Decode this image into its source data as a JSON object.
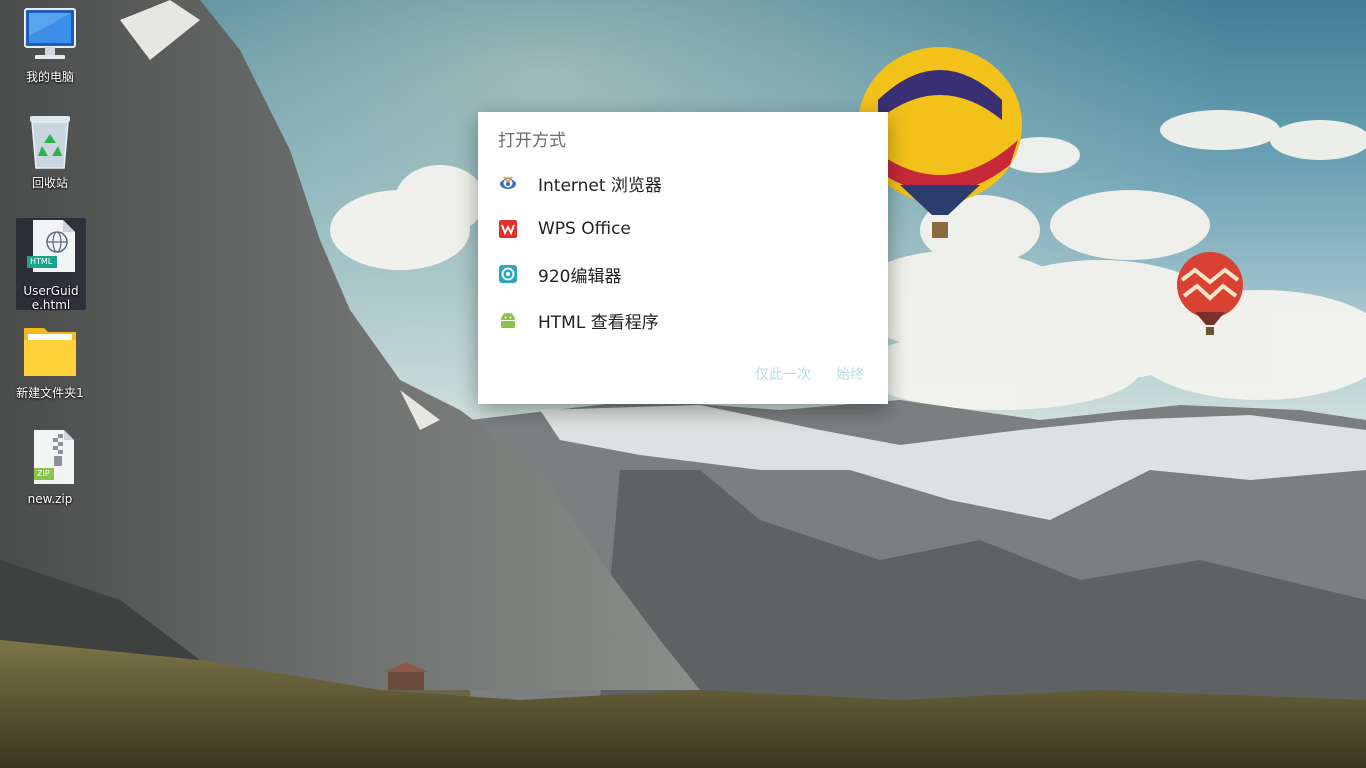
{
  "colors": {
    "dialog_bg": "#ffffff",
    "dialog_title": "#6b6b6b",
    "dialog_button_disabled": "#b7dde0",
    "icon_label": "#ffffff"
  },
  "desktop": {
    "icons": [
      {
        "label": "我的电脑",
        "icon": "computer-icon"
      },
      {
        "label": "回收站",
        "icon": "recycle-bin-icon"
      },
      {
        "label": "UserGuide.html",
        "icon": "html-file-icon",
        "badge": "HTML",
        "selected": true
      },
      {
        "label": "新建文件夹1",
        "icon": "folder-icon"
      },
      {
        "label": "new.zip",
        "icon": "zip-file-icon",
        "badge": "ZIP"
      }
    ]
  },
  "open_with_dialog": {
    "title": "打开方式",
    "apps": [
      {
        "name": "Internet 浏览器",
        "icon": "internet-browser-icon"
      },
      {
        "name": "WPS Office",
        "icon": "wps-office-icon"
      },
      {
        "name": "920编辑器",
        "icon": "920-editor-icon"
      },
      {
        "name": "HTML 查看程序",
        "icon": "android-icon"
      }
    ],
    "buttons": {
      "just_once": "仅此一次",
      "always": "始终"
    }
  }
}
